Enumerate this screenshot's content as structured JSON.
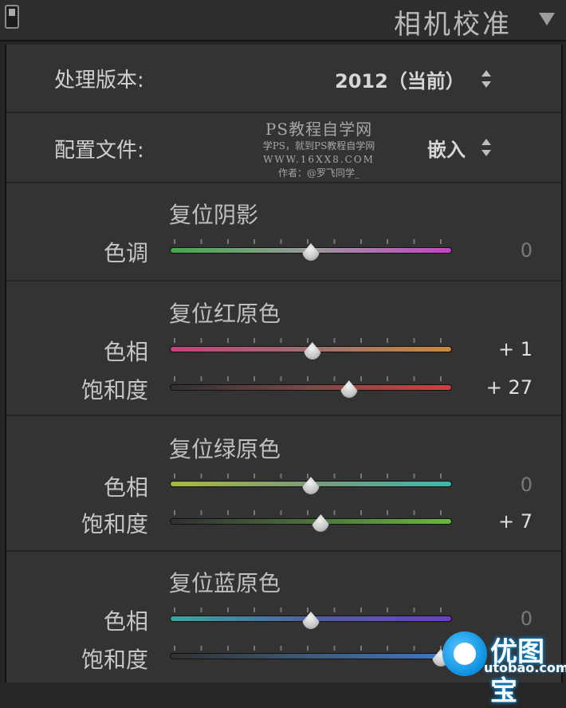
{
  "panel": {
    "title": "相机校准",
    "collapse_icon": "triangle-down-icon"
  },
  "process_version": {
    "label": "处理版本:",
    "value": "2012（当前）"
  },
  "profile": {
    "label": "配置文件:",
    "value": "嵌入"
  },
  "watermark": {
    "title": "PS教程自学网",
    "line1": "学PS，就到PS教程自学网",
    "line2": "WWW.16XX8.COM",
    "line3": "作者：@罗飞同学_"
  },
  "shadows": {
    "title": "复位阴影",
    "tint": {
      "label": "色调",
      "value_text": "0",
      "value": 0
    }
  },
  "red_primary": {
    "title": "复位红原色",
    "hue": {
      "label": "色相",
      "value_text": "+ 1",
      "value": 1
    },
    "saturation": {
      "label": "饱和度",
      "value_text": "+ 27",
      "value": 27
    }
  },
  "green_primary": {
    "title": "复位绿原色",
    "hue": {
      "label": "色相",
      "value_text": "0",
      "value": 0
    },
    "saturation": {
      "label": "饱和度",
      "value_text": "+ 7",
      "value": 7
    }
  },
  "blue_primary": {
    "title": "复位蓝原色",
    "hue": {
      "label": "色相",
      "value_text": "0",
      "value": 0
    },
    "saturation": {
      "label": "饱和度",
      "value": 92
    }
  },
  "colors": {
    "tint_track": [
      "#3fa84a",
      "#9a9a9a",
      "#c93fc9"
    ],
    "red_hue_track": [
      "#c8407a",
      "#9a7070",
      "#c98a3c"
    ],
    "red_sat_track": [
      "#303030",
      "#7a4a48",
      "#d04040"
    ],
    "green_hue_track": [
      "#a8b83a",
      "#7c9a7a",
      "#3ab8a8"
    ],
    "green_sat_track": [
      "#303030",
      "#4e7040",
      "#6ab83a"
    ],
    "blue_hue_track": [
      "#3aa8a0",
      "#5060a0",
      "#6a40c8"
    ],
    "blue_sat_track": [
      "#303030",
      "#3e5a78",
      "#3a78d0"
    ]
  },
  "brand": {
    "text": "优图宝",
    "url": "utobao.com",
    "icon": "utobao-logo-icon"
  }
}
